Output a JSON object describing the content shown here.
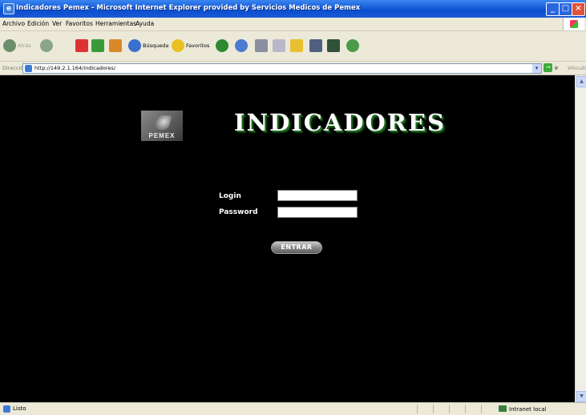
{
  "window": {
    "title": "Indicadores Pemex - Microsoft Internet Explorer provided by Servicios Medicos de Pemex"
  },
  "menu": [
    "Archivo",
    "Edición",
    "Ver",
    "Favoritos",
    "Herramientas",
    "Ayuda"
  ],
  "toolbar": {
    "back_label": "Atrás",
    "search_label": "Búsqueda",
    "favorites_label": "Favoritos"
  },
  "address": {
    "label": "Dirección",
    "url": "http://149.2.1.164/indicadores/",
    "go_label": "Ir",
    "links_label": "Vínculos"
  },
  "page": {
    "logo_text": "PEMEX",
    "heading": "INDICADORES",
    "login_label": "Login",
    "password_label": "Password",
    "login_value": "",
    "password_value": "",
    "submit_label": "ENTRAR"
  },
  "status": {
    "text": "Listo",
    "zone": "Intranet local"
  }
}
